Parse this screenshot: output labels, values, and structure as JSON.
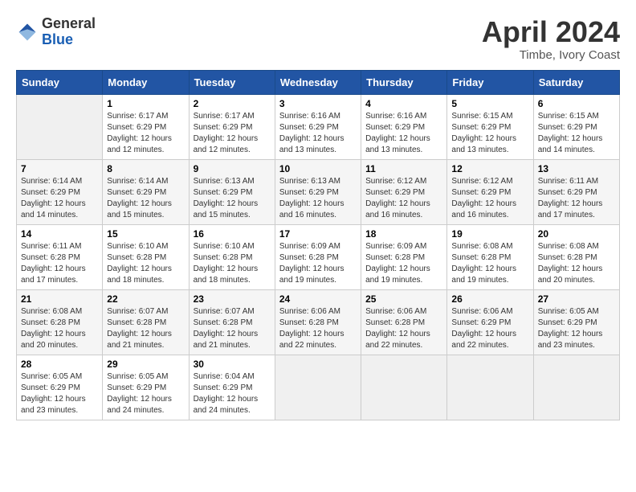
{
  "header": {
    "logo_general": "General",
    "logo_blue": "Blue",
    "month_year": "April 2024",
    "location": "Timbe, Ivory Coast"
  },
  "calendar": {
    "days_of_week": [
      "Sunday",
      "Monday",
      "Tuesday",
      "Wednesday",
      "Thursday",
      "Friday",
      "Saturday"
    ],
    "weeks": [
      [
        {
          "day": "",
          "info": ""
        },
        {
          "day": "1",
          "info": "Sunrise: 6:17 AM\nSunset: 6:29 PM\nDaylight: 12 hours and 12 minutes."
        },
        {
          "day": "2",
          "info": "Sunrise: 6:17 AM\nSunset: 6:29 PM\nDaylight: 12 hours and 12 minutes."
        },
        {
          "day": "3",
          "info": "Sunrise: 6:16 AM\nSunset: 6:29 PM\nDaylight: 12 hours and 13 minutes."
        },
        {
          "day": "4",
          "info": "Sunrise: 6:16 AM\nSunset: 6:29 PM\nDaylight: 12 hours and 13 minutes."
        },
        {
          "day": "5",
          "info": "Sunrise: 6:15 AM\nSunset: 6:29 PM\nDaylight: 12 hours and 13 minutes."
        },
        {
          "day": "6",
          "info": "Sunrise: 6:15 AM\nSunset: 6:29 PM\nDaylight: 12 hours and 14 minutes."
        }
      ],
      [
        {
          "day": "7",
          "info": "Sunrise: 6:14 AM\nSunset: 6:29 PM\nDaylight: 12 hours and 14 minutes."
        },
        {
          "day": "8",
          "info": "Sunrise: 6:14 AM\nSunset: 6:29 PM\nDaylight: 12 hours and 15 minutes."
        },
        {
          "day": "9",
          "info": "Sunrise: 6:13 AM\nSunset: 6:29 PM\nDaylight: 12 hours and 15 minutes."
        },
        {
          "day": "10",
          "info": "Sunrise: 6:13 AM\nSunset: 6:29 PM\nDaylight: 12 hours and 16 minutes."
        },
        {
          "day": "11",
          "info": "Sunrise: 6:12 AM\nSunset: 6:29 PM\nDaylight: 12 hours and 16 minutes."
        },
        {
          "day": "12",
          "info": "Sunrise: 6:12 AM\nSunset: 6:29 PM\nDaylight: 12 hours and 16 minutes."
        },
        {
          "day": "13",
          "info": "Sunrise: 6:11 AM\nSunset: 6:29 PM\nDaylight: 12 hours and 17 minutes."
        }
      ],
      [
        {
          "day": "14",
          "info": "Sunrise: 6:11 AM\nSunset: 6:28 PM\nDaylight: 12 hours and 17 minutes."
        },
        {
          "day": "15",
          "info": "Sunrise: 6:10 AM\nSunset: 6:28 PM\nDaylight: 12 hours and 18 minutes."
        },
        {
          "day": "16",
          "info": "Sunrise: 6:10 AM\nSunset: 6:28 PM\nDaylight: 12 hours and 18 minutes."
        },
        {
          "day": "17",
          "info": "Sunrise: 6:09 AM\nSunset: 6:28 PM\nDaylight: 12 hours and 19 minutes."
        },
        {
          "day": "18",
          "info": "Sunrise: 6:09 AM\nSunset: 6:28 PM\nDaylight: 12 hours and 19 minutes."
        },
        {
          "day": "19",
          "info": "Sunrise: 6:08 AM\nSunset: 6:28 PM\nDaylight: 12 hours and 19 minutes."
        },
        {
          "day": "20",
          "info": "Sunrise: 6:08 AM\nSunset: 6:28 PM\nDaylight: 12 hours and 20 minutes."
        }
      ],
      [
        {
          "day": "21",
          "info": "Sunrise: 6:08 AM\nSunset: 6:28 PM\nDaylight: 12 hours and 20 minutes."
        },
        {
          "day": "22",
          "info": "Sunrise: 6:07 AM\nSunset: 6:28 PM\nDaylight: 12 hours and 21 minutes."
        },
        {
          "day": "23",
          "info": "Sunrise: 6:07 AM\nSunset: 6:28 PM\nDaylight: 12 hours and 21 minutes."
        },
        {
          "day": "24",
          "info": "Sunrise: 6:06 AM\nSunset: 6:28 PM\nDaylight: 12 hours and 22 minutes."
        },
        {
          "day": "25",
          "info": "Sunrise: 6:06 AM\nSunset: 6:28 PM\nDaylight: 12 hours and 22 minutes."
        },
        {
          "day": "26",
          "info": "Sunrise: 6:06 AM\nSunset: 6:29 PM\nDaylight: 12 hours and 22 minutes."
        },
        {
          "day": "27",
          "info": "Sunrise: 6:05 AM\nSunset: 6:29 PM\nDaylight: 12 hours and 23 minutes."
        }
      ],
      [
        {
          "day": "28",
          "info": "Sunrise: 6:05 AM\nSunset: 6:29 PM\nDaylight: 12 hours and 23 minutes."
        },
        {
          "day": "29",
          "info": "Sunrise: 6:05 AM\nSunset: 6:29 PM\nDaylight: 12 hours and 24 minutes."
        },
        {
          "day": "30",
          "info": "Sunrise: 6:04 AM\nSunset: 6:29 PM\nDaylight: 12 hours and 24 minutes."
        },
        {
          "day": "",
          "info": ""
        },
        {
          "day": "",
          "info": ""
        },
        {
          "day": "",
          "info": ""
        },
        {
          "day": "",
          "info": ""
        }
      ]
    ]
  }
}
